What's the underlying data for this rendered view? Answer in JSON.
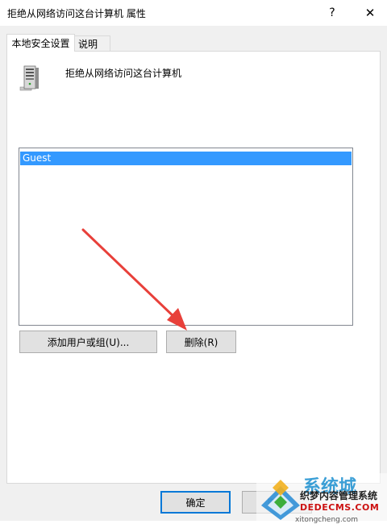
{
  "window": {
    "title": "拒绝从网络访问这台计算机 属性",
    "help_glyph": "?",
    "close_glyph": "✕"
  },
  "tabs": [
    {
      "label": "本地安全设置",
      "active": true
    },
    {
      "label": "说明",
      "active": false
    }
  ],
  "policy": {
    "icon": "server-icon",
    "name": "拒绝从网络访问这台计算机"
  },
  "accounts": {
    "items": [
      "Guest"
    ],
    "selected": "Guest"
  },
  "buttons": {
    "add_label": "添加用户或组(U)...",
    "remove_label": "删除(R)",
    "ok_label": "确定",
    "cancel_label": "取消"
  },
  "annotation": {
    "icon": "red-arrow-icon",
    "color": "#e8403a"
  },
  "watermark": {
    "brand": "系统城",
    "line1": "织梦内容管理系统",
    "line2": "DEDECMS.COM",
    "domain": "xitongcheng.com"
  },
  "colors": {
    "selection": "#3399ff",
    "dialog_bg": "#f0f0f0",
    "accent": "#0078d7"
  }
}
